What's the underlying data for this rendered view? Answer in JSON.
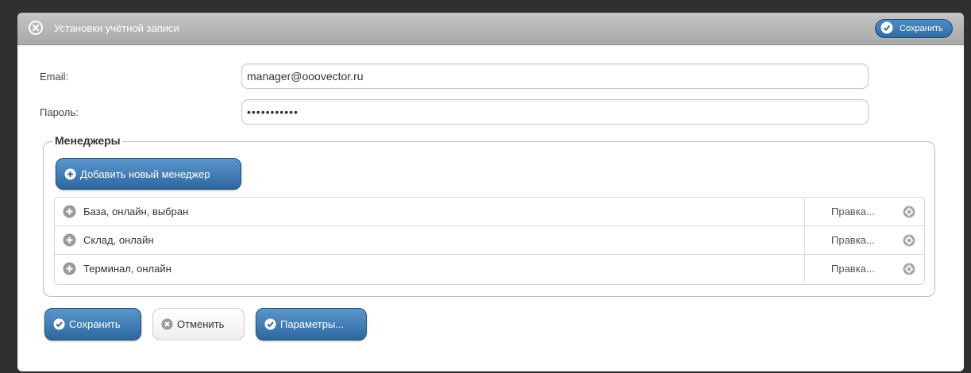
{
  "dialog": {
    "title": "Установки учётной записи",
    "header_save_label": "Сохранить"
  },
  "form": {
    "email_label": "Email:",
    "email_value": "manager@ooovector.ru",
    "password_label": "Пароль:",
    "password_value": "***********"
  },
  "managers": {
    "legend": "Менеджеры",
    "add_label": "Добавить новый менеджер",
    "items": [
      {
        "name": "База, онлайн, выбран",
        "edit": "Правка..."
      },
      {
        "name": "Склад, онлайн",
        "edit": "Правка..."
      },
      {
        "name": "Терминал, онлайн",
        "edit": "Правка..."
      }
    ]
  },
  "footer": {
    "save_label": "Сохранить",
    "cancel_label": "Отменить",
    "params_label": "Параметры..."
  },
  "colors": {
    "accent_blue": "#2e67a0",
    "titlebar": "#b5b5b5",
    "frame": "#303030"
  }
}
